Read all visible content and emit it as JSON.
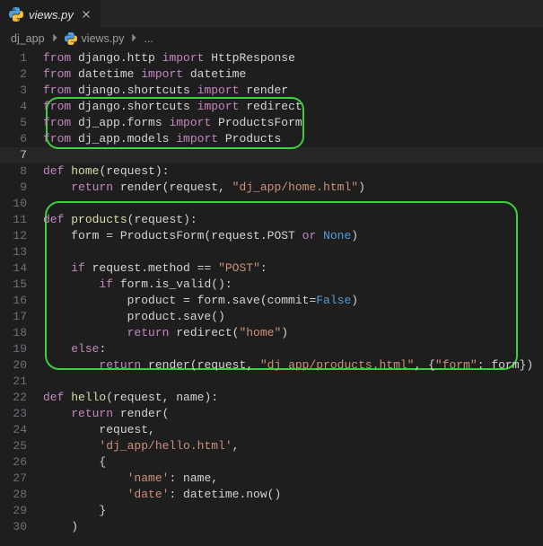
{
  "tab": {
    "filename": "views.py"
  },
  "breadcrumbs": {
    "a": "dj_app",
    "b": "views.py",
    "c": "..."
  },
  "lines": {
    "l1": [
      [
        "kw",
        "from"
      ],
      [
        "txt",
        " django.http "
      ],
      [
        "kw",
        "import"
      ],
      [
        "txt",
        " HttpResponse"
      ]
    ],
    "l2": [
      [
        "kw",
        "from"
      ],
      [
        "txt",
        " datetime "
      ],
      [
        "kw",
        "import"
      ],
      [
        "txt",
        " datetime"
      ]
    ],
    "l3": [
      [
        "kw",
        "from"
      ],
      [
        "txt",
        " django.shortcuts "
      ],
      [
        "kw",
        "import"
      ],
      [
        "txt",
        " render"
      ]
    ],
    "l4": [
      [
        "kw",
        "from"
      ],
      [
        "txt",
        " django.shortcuts "
      ],
      [
        "kw",
        "import"
      ],
      [
        "txt",
        " redirect"
      ]
    ],
    "l5": [
      [
        "kw",
        "from"
      ],
      [
        "txt",
        " dj_app.forms "
      ],
      [
        "kw",
        "import"
      ],
      [
        "txt",
        " ProductsForm"
      ]
    ],
    "l6": [
      [
        "kw",
        "from"
      ],
      [
        "txt",
        " dj_app.models "
      ],
      [
        "kw",
        "import"
      ],
      [
        "txt",
        " Products"
      ]
    ],
    "l7": [],
    "l8": [
      [
        "kw",
        "def"
      ],
      [
        "txt",
        " "
      ],
      [
        "fn",
        "home"
      ],
      [
        "txt",
        "(request):"
      ]
    ],
    "l9": [
      [
        "txt",
        "    "
      ],
      [
        "kw",
        "return"
      ],
      [
        "txt",
        " render(request, "
      ],
      [
        "str",
        "\"dj_app/home.html\""
      ],
      [
        "txt",
        ")"
      ]
    ],
    "l10": [],
    "l11": [
      [
        "kw",
        "def"
      ],
      [
        "txt",
        " "
      ],
      [
        "fn",
        "products"
      ],
      [
        "txt",
        "(request):"
      ]
    ],
    "l12": [
      [
        "txt",
        "    form = ProductsForm(request.POST "
      ],
      [
        "kw",
        "or"
      ],
      [
        "txt",
        " "
      ],
      [
        "lit",
        "None"
      ],
      [
        "txt",
        ")"
      ]
    ],
    "l13": [],
    "l14": [
      [
        "txt",
        "    "
      ],
      [
        "kw",
        "if"
      ],
      [
        "txt",
        " request.method == "
      ],
      [
        "str",
        "\"POST\""
      ],
      [
        "txt",
        ":"
      ]
    ],
    "l15": [
      [
        "txt",
        "        "
      ],
      [
        "kw",
        "if"
      ],
      [
        "txt",
        " form.is_valid():"
      ]
    ],
    "l16": [
      [
        "txt",
        "            product = form.save(commit="
      ],
      [
        "lit",
        "False"
      ],
      [
        "txt",
        ")"
      ]
    ],
    "l17": [
      [
        "txt",
        "            product.save()"
      ]
    ],
    "l18": [
      [
        "txt",
        "            "
      ],
      [
        "kw",
        "return"
      ],
      [
        "txt",
        " redirect("
      ],
      [
        "str",
        "\"home\""
      ],
      [
        "txt",
        ")"
      ]
    ],
    "l19": [
      [
        "txt",
        "    "
      ],
      [
        "kw",
        "else"
      ],
      [
        "txt",
        ":"
      ]
    ],
    "l20": [
      [
        "txt",
        "        "
      ],
      [
        "kw",
        "return"
      ],
      [
        "txt",
        " render(request, "
      ],
      [
        "str",
        "\"dj_app/products.html\""
      ],
      [
        "txt",
        ", {"
      ],
      [
        "str",
        "\"form\""
      ],
      [
        "txt",
        ": form})"
      ]
    ],
    "l21": [],
    "l22": [
      [
        "kw",
        "def"
      ],
      [
        "txt",
        " "
      ],
      [
        "fn",
        "hello"
      ],
      [
        "txt",
        "(request, name):"
      ]
    ],
    "l23": [
      [
        "txt",
        "    "
      ],
      [
        "kw",
        "return"
      ],
      [
        "txt",
        " render("
      ]
    ],
    "l24": [
      [
        "txt",
        "        request,"
      ]
    ],
    "l25": [
      [
        "txt",
        "        "
      ],
      [
        "str",
        "'dj_app/hello.html'"
      ],
      [
        "txt",
        ","
      ]
    ],
    "l26": [
      [
        "txt",
        "        {"
      ]
    ],
    "l27": [
      [
        "txt",
        "            "
      ],
      [
        "str",
        "'name'"
      ],
      [
        "txt",
        ": name,"
      ]
    ],
    "l28": [
      [
        "txt",
        "            "
      ],
      [
        "str",
        "'date'"
      ],
      [
        "txt",
        ": datetime.now()"
      ]
    ],
    "l29": [
      [
        "txt",
        "        }"
      ]
    ],
    "l30": [
      [
        "txt",
        "    )"
      ]
    ]
  },
  "lineCount": 30,
  "activeLine": 7
}
